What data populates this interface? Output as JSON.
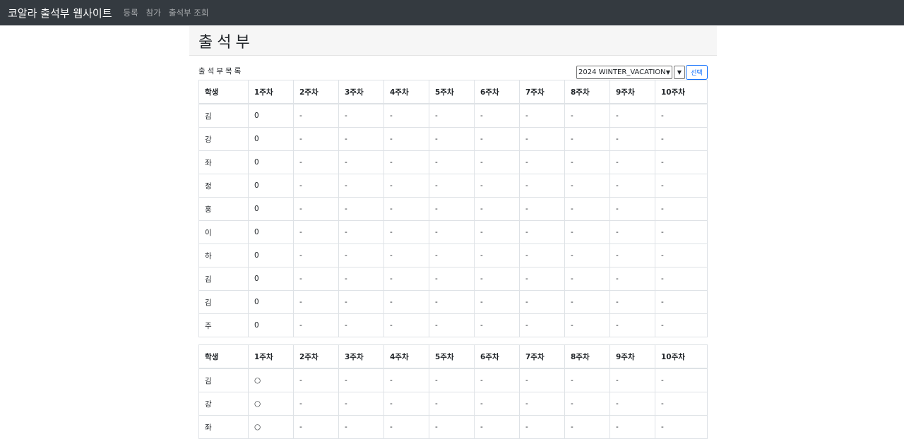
{
  "navbar": {
    "brand": "코알라 출석부 웹사이트",
    "links": [
      "등록",
      "참가",
      "출석부 조회"
    ]
  },
  "page": {
    "title": "출석부",
    "list_label": "출석부목록",
    "term_select_value": "2024 WINTER_VACATION",
    "select_button": "선택"
  },
  "tables": [
    {
      "headers": [
        "학생",
        "1주차",
        "2주차",
        "3주차",
        "4주차",
        "5주차",
        "6주차",
        "7주차",
        "8주차",
        "9주차",
        "10주차"
      ],
      "rows": [
        [
          "김",
          "0",
          "-",
          "-",
          "-",
          "-",
          "-",
          "-",
          "-",
          "-",
          "-"
        ],
        [
          "강",
          "0",
          "-",
          "-",
          "-",
          "-",
          "-",
          "-",
          "-",
          "-",
          "-"
        ],
        [
          "좌",
          "0",
          "-",
          "-",
          "-",
          "-",
          "-",
          "-",
          "-",
          "-",
          "-"
        ],
        [
          "정",
          "0",
          "-",
          "-",
          "-",
          "-",
          "-",
          "-",
          "-",
          "-",
          "-"
        ],
        [
          "홍",
          "0",
          "-",
          "-",
          "-",
          "-",
          "-",
          "-",
          "-",
          "-",
          "-"
        ],
        [
          "이",
          "0",
          "-",
          "-",
          "-",
          "-",
          "-",
          "-",
          "-",
          "-",
          "-"
        ],
        [
          "하",
          "0",
          "-",
          "-",
          "-",
          "-",
          "-",
          "-",
          "-",
          "-",
          "-"
        ],
        [
          "김",
          "0",
          "-",
          "-",
          "-",
          "-",
          "-",
          "-",
          "-",
          "-",
          "-"
        ],
        [
          "김",
          "0",
          "-",
          "-",
          "-",
          "-",
          "-",
          "-",
          "-",
          "-",
          "-"
        ],
        [
          "주",
          "0",
          "-",
          "-",
          "-",
          "-",
          "-",
          "-",
          "-",
          "-",
          "-"
        ]
      ]
    },
    {
      "headers": [
        "학생",
        "1주차",
        "2주차",
        "3주차",
        "4주차",
        "5주차",
        "6주차",
        "7주차",
        "8주차",
        "9주차",
        "10주차"
      ],
      "rows": [
        [
          "김",
          "○",
          "-",
          "-",
          "-",
          "-",
          "-",
          "-",
          "-",
          "-",
          "-"
        ],
        [
          "강",
          "○",
          "-",
          "-",
          "-",
          "-",
          "-",
          "-",
          "-",
          "-",
          "-"
        ],
        [
          "좌",
          "○",
          "-",
          "-",
          "-",
          "-",
          "-",
          "-",
          "-",
          "-",
          "-"
        ]
      ]
    }
  ]
}
